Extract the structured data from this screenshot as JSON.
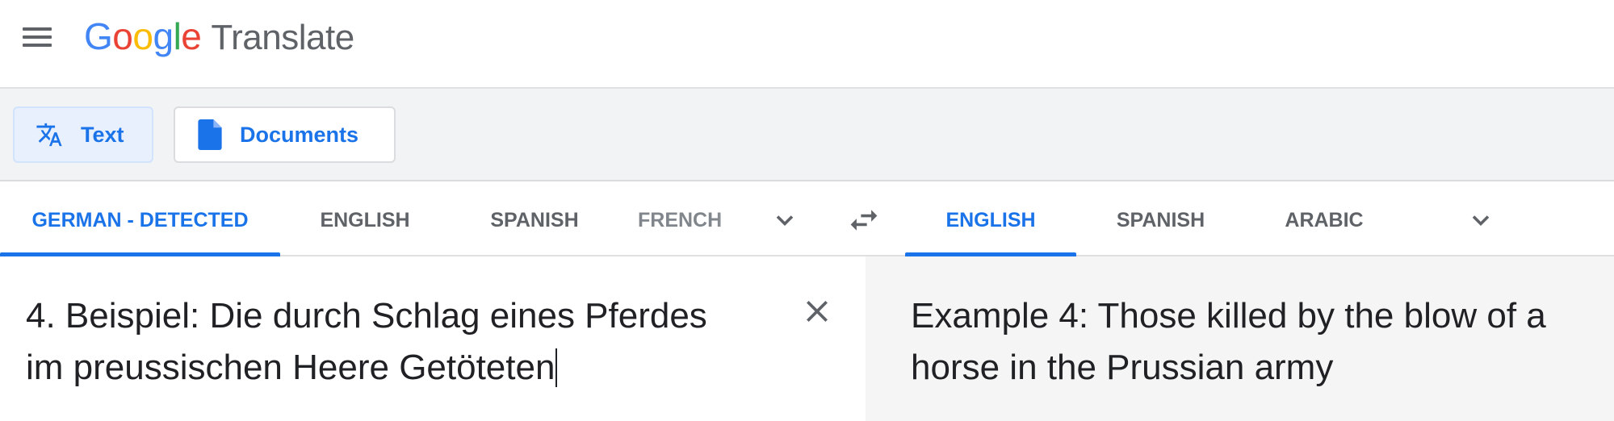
{
  "header": {
    "logo_letters": [
      "G",
      "o",
      "o",
      "g",
      "l",
      "e"
    ],
    "product_name": "Translate",
    "menu_icon": "hamburger-menu-icon"
  },
  "modes": {
    "text_label": "Text",
    "text_icon": "translate-icon",
    "documents_label": "Documents",
    "documents_icon": "document-icon",
    "active": "text"
  },
  "source_languages": {
    "items": [
      "GERMAN - DETECTED",
      "ENGLISH",
      "SPANISH",
      "FRENCH"
    ],
    "active_index": 0
  },
  "target_languages": {
    "items": [
      "ENGLISH",
      "SPANISH",
      "ARABIC"
    ],
    "active_index": 0
  },
  "source": {
    "text": "4. Beispiel: Die durch Schlag eines Pferdes\nim preussischen Heere Getöteten"
  },
  "target": {
    "text": "Example 4: Those killed by the blow of a\nhorse in the Prussian army"
  },
  "colors": {
    "accent": "#1a73e8",
    "text_mode_bg": "#e8f0fe",
    "target_pane_bg": "#f5f5f5"
  }
}
